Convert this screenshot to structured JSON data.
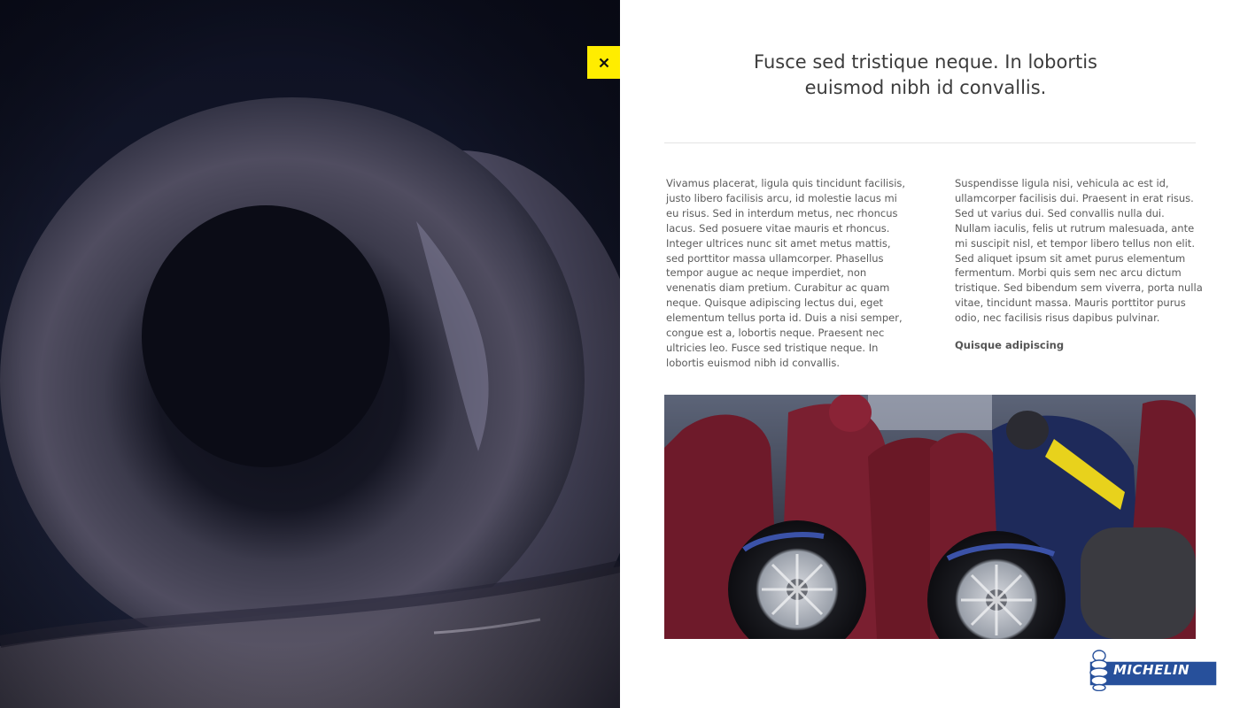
{
  "close_button": {
    "label": "×",
    "color": "#ffed00"
  },
  "article": {
    "heading": "Fusce sed tristique neque. In lobortis euismod nibh id convallis.",
    "column_left": "Vivamus placerat, ligula quis tincidunt facilisis, justo libero facilisis arcu, id molestie lacus mi eu risus. Sed in interdum metus, nec rhoncus lacus. Sed posuere vitae mauris et rhoncus. Integer ultrices nunc sit amet metus mattis, sed porttitor massa ullamcorper. Phasellus tempor augue ac neque imperdiet, non venenatis diam pretium. Curabitur ac quam neque. Quisque adipiscing lectus dui, eget elementum tellus porta id. Duis a nisi semper, congue est a, lobortis neque. Praesent nec ultricies leo. Fusce sed tristique neque. In lobortis euismod nibh id convallis.",
    "column_right": "Suspendisse ligula nisi, vehicula ac est id, ullamcorper facilisis dui. Praesent in erat risus. Sed ut varius dui. Sed convallis nulla dui. Nullam iaculis, felis ut rutrum malesuada, ante mi suscipit nisl, et tempor libero tellus non elit. Sed aliquet ipsum sit amet purus elementum fermentum. Morbi quis sem nec arcu dictum tristique. Sed bibendum sem viverra, porta nulla vitae, tincidunt massa. Mauris porttitor purus odio, nec facilisis risus dapibus pulvinar.",
    "column_right_link": "Quisque adipiscing"
  },
  "logo": {
    "text": "MICHELIN",
    "color": "#27509b"
  },
  "icons": {
    "close": "close-icon",
    "logo_mascot": "michelin-man-icon"
  }
}
